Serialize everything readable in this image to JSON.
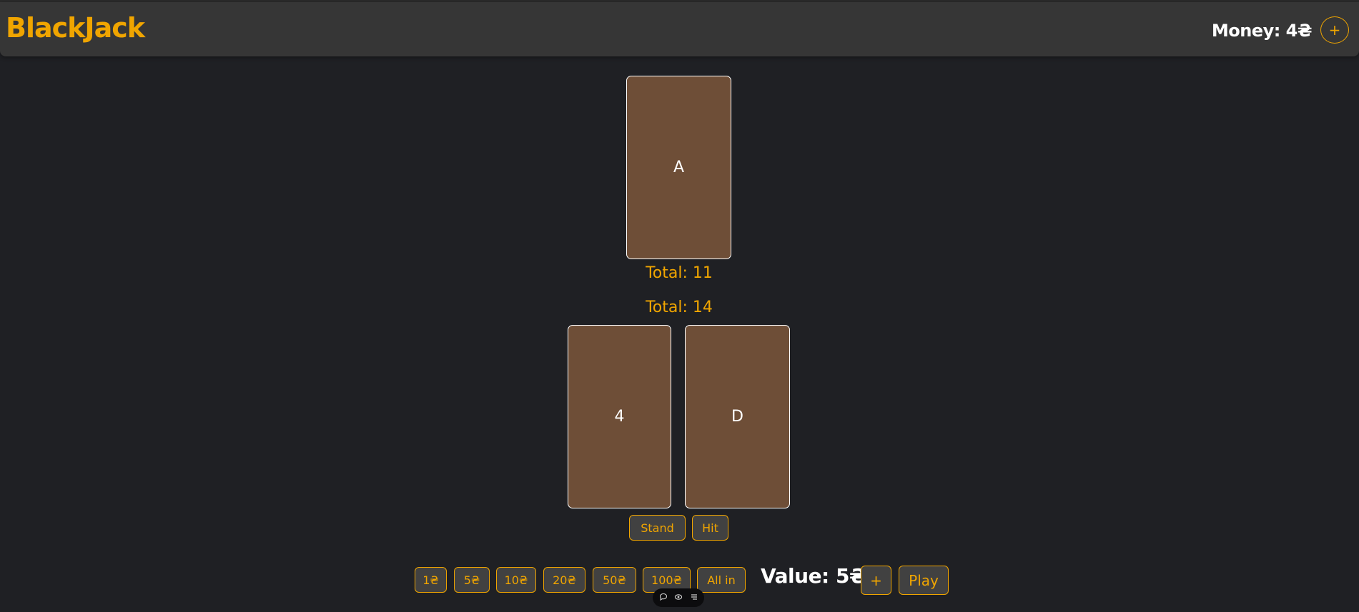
{
  "header": {
    "title": "BlackJack",
    "money_label": "Money: 4₴",
    "add_money_label": "+"
  },
  "dealer": {
    "cards": [
      "A"
    ],
    "total_label": "Total: 11"
  },
  "player": {
    "total_label": "Total: 14",
    "cards": [
      "4",
      "D"
    ],
    "actions": {
      "stand_label": "Stand",
      "hit_label": "Hit"
    }
  },
  "betting": {
    "chips": [
      "1₴",
      "5₴",
      "10₴",
      "20₴",
      "50₴",
      "100₴",
      "All in"
    ],
    "value_label": "Value: 5₴",
    "add_label": "+",
    "play_label": "Play"
  },
  "tray_icons": [
    "comment-icon",
    "eye-icon",
    "menu-icon"
  ],
  "colors": {
    "accent": "#f0a500",
    "background": "#1f2024",
    "header": "#363636",
    "card": "#6e4e37",
    "button": "#414141"
  }
}
